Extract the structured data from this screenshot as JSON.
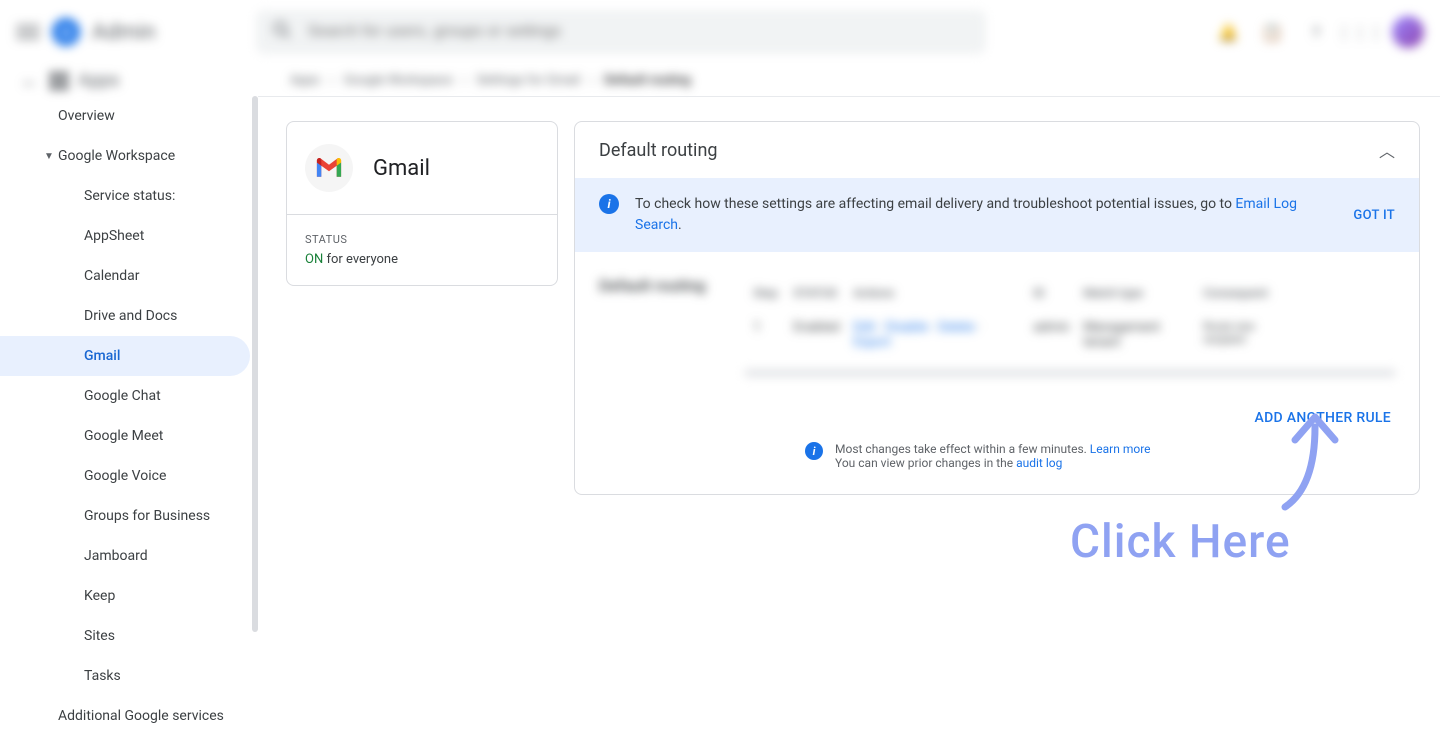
{
  "topbar": {
    "product": "Admin",
    "search_placeholder": "Search for users, groups or settings"
  },
  "apps_label": "Apps",
  "breadcrumbs": [
    "Apps",
    "Google Workspace",
    "Settings for Gmail",
    "Default routing"
  ],
  "sidebar": {
    "items": [
      {
        "label": "Overview"
      },
      {
        "label": "Google Workspace"
      },
      {
        "label": "Service status:"
      },
      {
        "label": "AppSheet"
      },
      {
        "label": "Calendar"
      },
      {
        "label": "Drive and Docs"
      },
      {
        "label": "Gmail"
      },
      {
        "label": "Google Chat"
      },
      {
        "label": "Google Meet"
      },
      {
        "label": "Google Voice"
      },
      {
        "label": "Groups for Business"
      },
      {
        "label": "Jamboard"
      },
      {
        "label": "Keep"
      },
      {
        "label": "Sites"
      },
      {
        "label": "Tasks"
      },
      {
        "label": "Additional Google services"
      }
    ]
  },
  "app_card": {
    "title": "Gmail",
    "status_label": "STATUS",
    "status_on": "ON",
    "status_text": " for everyone"
  },
  "panel": {
    "title": "Default routing",
    "info_text_prefix": "To check how these settings are affecting email delivery and troubleshoot potential issues, go to ",
    "info_link": "Email Log Search",
    "info_period": ".",
    "got_it": "GOT IT",
    "blurred_label": "Default routing",
    "table_head": [
      "Step",
      "STATUS",
      "Actions",
      "ID",
      "Match type",
      "Consequent"
    ],
    "table_row": [
      "1",
      "Enabled",
      "Edit",
      "Disable",
      "Delete",
      "Export",
      "admin",
      "Management tenant",
      "Route new recipient"
    ],
    "add_rule": "ADD ANOTHER RULE",
    "footer_line1": "Most changes take effect within a few minutes. ",
    "footer_learn": "Learn more",
    "footer_line2": "You can view prior changes in the ",
    "footer_audit": "audit log"
  },
  "annotation": {
    "label": "Click Here"
  }
}
